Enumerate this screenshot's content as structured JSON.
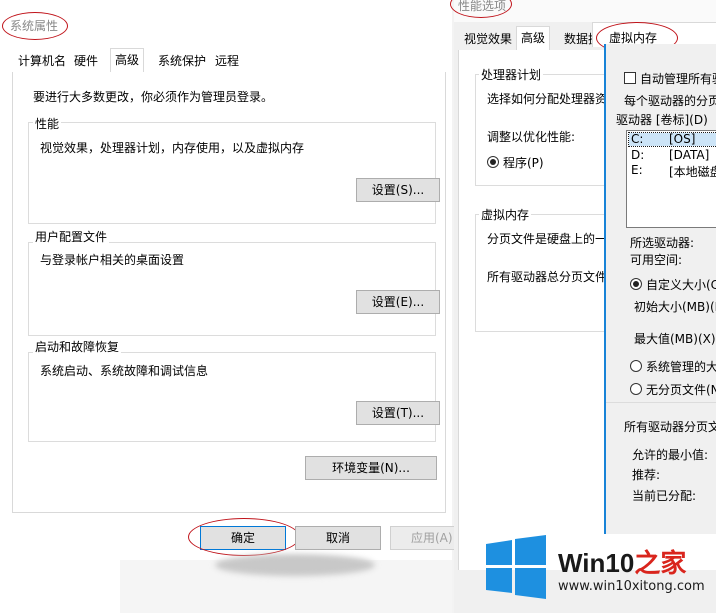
{
  "system_properties": {
    "title": "系统属性",
    "tabs": [
      "计算机名",
      "硬件",
      "高级",
      "系统保护",
      "远程"
    ],
    "active_tab": "高级",
    "admin_note": "要进行大多数更改，你必须作为管理员登录。",
    "performance": {
      "title": "性能",
      "desc": "视觉效果，处理器计划，内存使用，以及虚拟内存",
      "button": "设置(S)..."
    },
    "user_profiles": {
      "title": "用户配置文件",
      "desc": "与登录帐户相关的桌面设置",
      "button": "设置(E)..."
    },
    "startup_recovery": {
      "title": "启动和故障恢复",
      "desc": "系统启动、系统故障和调试信息",
      "button": "设置(T)..."
    },
    "env_button": "环境变量(N)...",
    "ok": "确定",
    "cancel": "取消",
    "apply": "应用(A)"
  },
  "performance_options": {
    "title": "性能选项",
    "tabs": [
      "视觉效果",
      "高级",
      "数据执"
    ],
    "processor": {
      "title": "处理器计划",
      "desc": "选择如何分配处理器资",
      "adjust": "调整以优化性能:",
      "radio": "程序(P)"
    },
    "vm": {
      "title": "虚拟内存",
      "desc": "分页文件是硬盘上的一",
      "total": "所有驱动器总分页文件"
    }
  },
  "virtual_memory": {
    "title": "虚拟内存",
    "auto_manage": "自动管理所有驱",
    "per_drive": "每个驱动器的分页",
    "drive_header": "驱动器 [卷标](D)",
    "drives": [
      {
        "letter": "C:",
        "label": "[OS]"
      },
      {
        "letter": "D:",
        "label": "[DATA]"
      },
      {
        "letter": "E:",
        "label": "[本地磁盘"
      }
    ],
    "selected_drive": "所选驱动器:",
    "available": "可用空间:",
    "custom": "自定义大小(C",
    "initial": "初始大小(MB)(I)",
    "max": "最大值(MB)(X):",
    "system_managed": "系统管理的大",
    "no_paging": "无分页文件(N",
    "all_drives": "所有驱动器分页文",
    "min_allowed": "允许的最小值:",
    "recommended": "推荐:",
    "current": "当前已分配:"
  },
  "watermark": {
    "brand": "Win10",
    "brand_suffix": "之家",
    "url": "www.win10xitong.com",
    "colors": {
      "blue": "#1e90e0",
      "dark": "#1a1a1a",
      "red": "#d9251d"
    }
  },
  "annotation_color": "#c0141b"
}
